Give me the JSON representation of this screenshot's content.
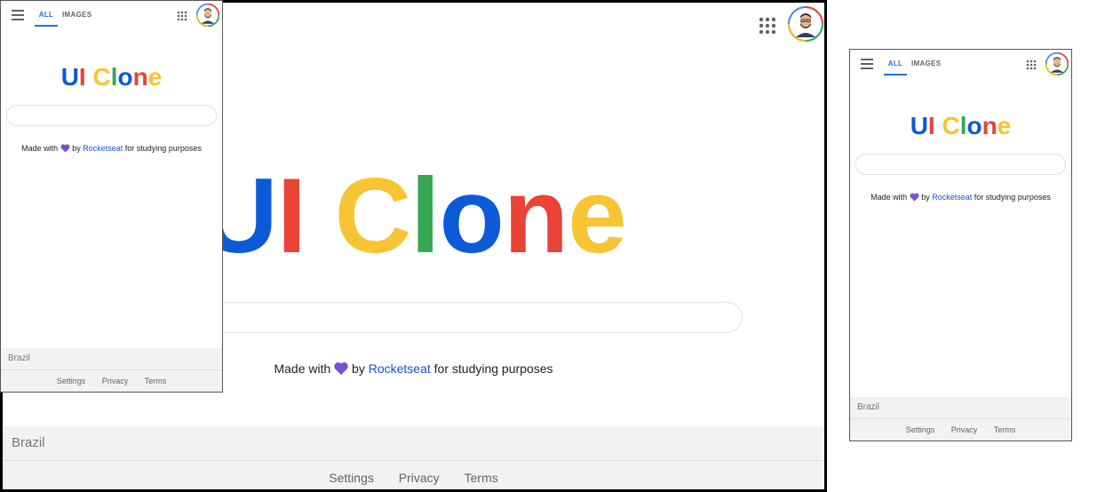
{
  "logo": {
    "u": "U",
    "i": "I",
    "c": "C",
    "l": "l",
    "o": "o",
    "n": "n",
    "e": "e"
  },
  "tabs": {
    "all": "ALL",
    "images": "IMAGES"
  },
  "credit": {
    "made_with": "Made with",
    "by": "by",
    "author": "Rocketseat",
    "suffix": "for studying purposes"
  },
  "footer": {
    "country": "Brazil",
    "settings": "Settings",
    "privacy": "Privacy",
    "terms": "Terms"
  },
  "icons": {
    "menu": "hamburger-menu-icon",
    "apps": "apps-grid-icon",
    "heart": "purple-heart-icon",
    "avatar": "user-avatar"
  },
  "colors": {
    "accent": "#1a73e8",
    "heart": "#7b4fd8",
    "footer_bg": "#f2f2f2"
  }
}
